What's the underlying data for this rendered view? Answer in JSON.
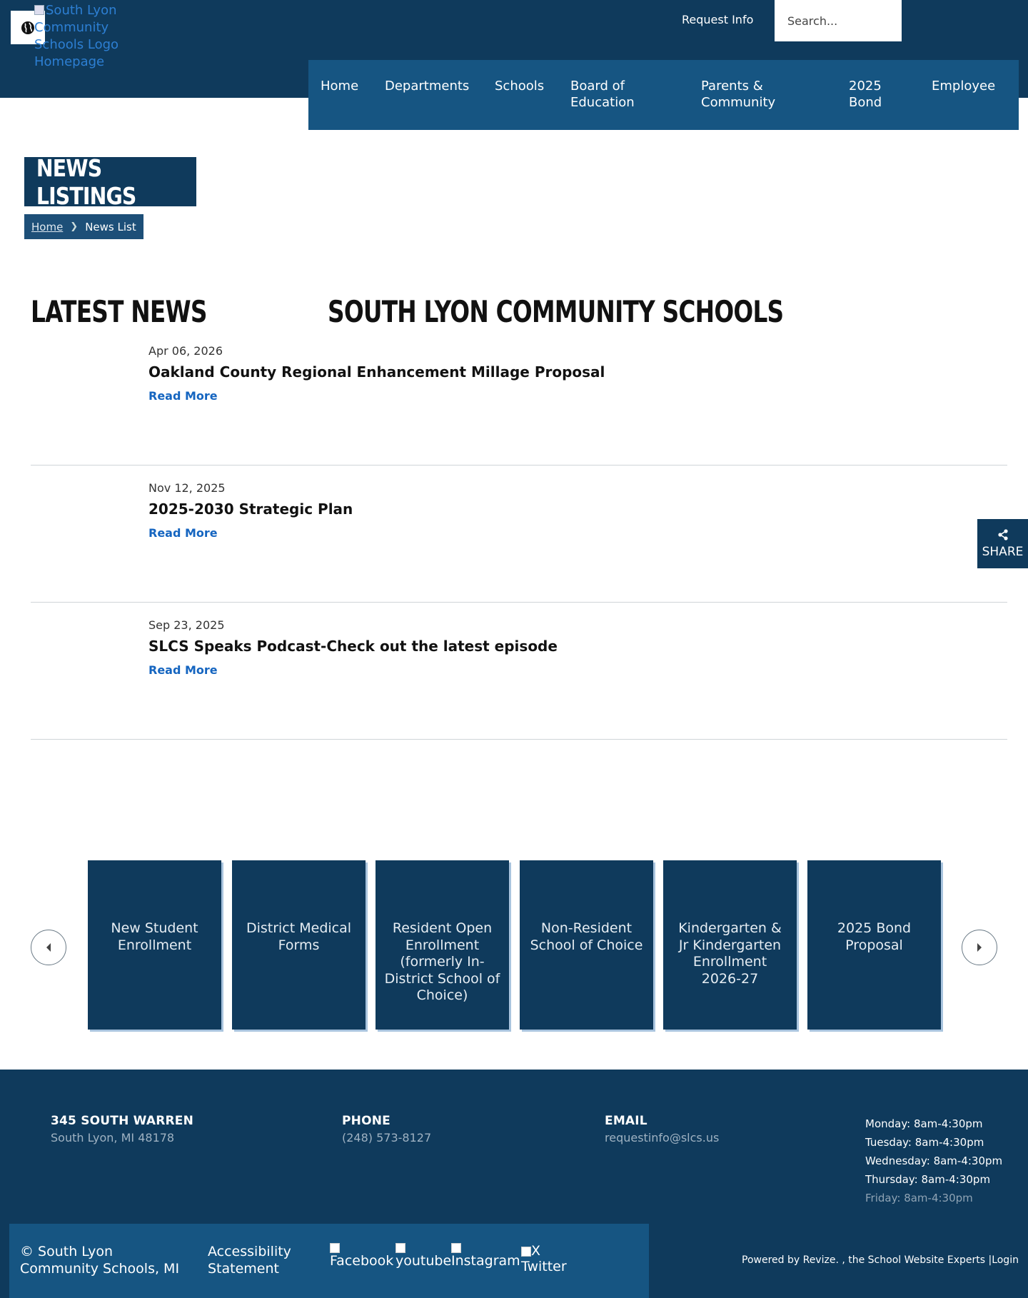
{
  "header": {
    "logo_alt": "South Lyon Community Schools Logo Homepage",
    "request_info": "Request Info",
    "search_placeholder": "Search..."
  },
  "nav": {
    "items": [
      "Home",
      "Departments",
      "Schools",
      "Board of Education",
      "Parents & Community",
      "2025 Bond",
      "Employee"
    ]
  },
  "page": {
    "title": "NEWS LISTINGS",
    "breadcrumb_home": "Home",
    "breadcrumb_current": "News List",
    "section_left": "LATEST NEWS",
    "section_right": "SOUTH LYON COMMUNITY SCHOOLS"
  },
  "news": [
    {
      "date": "Apr 06, 2026",
      "title": "Oakland County Regional Enhancement Millage Proposal",
      "link": "Read More"
    },
    {
      "date": "Nov 12, 2025",
      "title": "2025-2030 Strategic Plan",
      "link": "Read More"
    },
    {
      "date": "Sep 23, 2025",
      "title": "SLCS Speaks Podcast-Check out the latest episode",
      "link": "Read More"
    }
  ],
  "share": {
    "label": "SHARE",
    "icon": "share-icon"
  },
  "quick_links": [
    "New Student Enrollment",
    "District Medical Forms",
    "Resident Open Enrollment (formerly In-District School of Choice)",
    "Non-Resident School of Choice",
    "Kindergarten & Jr Kindergarten Enrollment 2026-27",
    "2025 Bond Proposal"
  ],
  "footer": {
    "address_heading": "345 SOUTH WARREN",
    "address_sub": "South Lyon, MI 48178",
    "phone_heading": "PHONE",
    "phone": "(248) 573-8127",
    "email_heading": "EMAIL",
    "email": "requestinfo@slcs.us",
    "hours": [
      "Monday: 8am-4:30pm",
      "Tuesday: 8am-4:30pm",
      "Wednesday: 8am-4:30pm",
      "Thursday: 8am-4:30pm",
      "Friday: 8am-4:30pm"
    ],
    "copyright": "© South Lyon Community Schools, MI",
    "accessibility": "Accessibility Statement",
    "social": [
      "Facebook",
      "youtube",
      "Instagram",
      "X Twitter"
    ],
    "powered": "Powered by Revize. , the School Website Experts |Login"
  },
  "colors": {
    "navy": "#0f3a5c",
    "nav_blue": "#165582",
    "link_blue": "#1565c0"
  }
}
